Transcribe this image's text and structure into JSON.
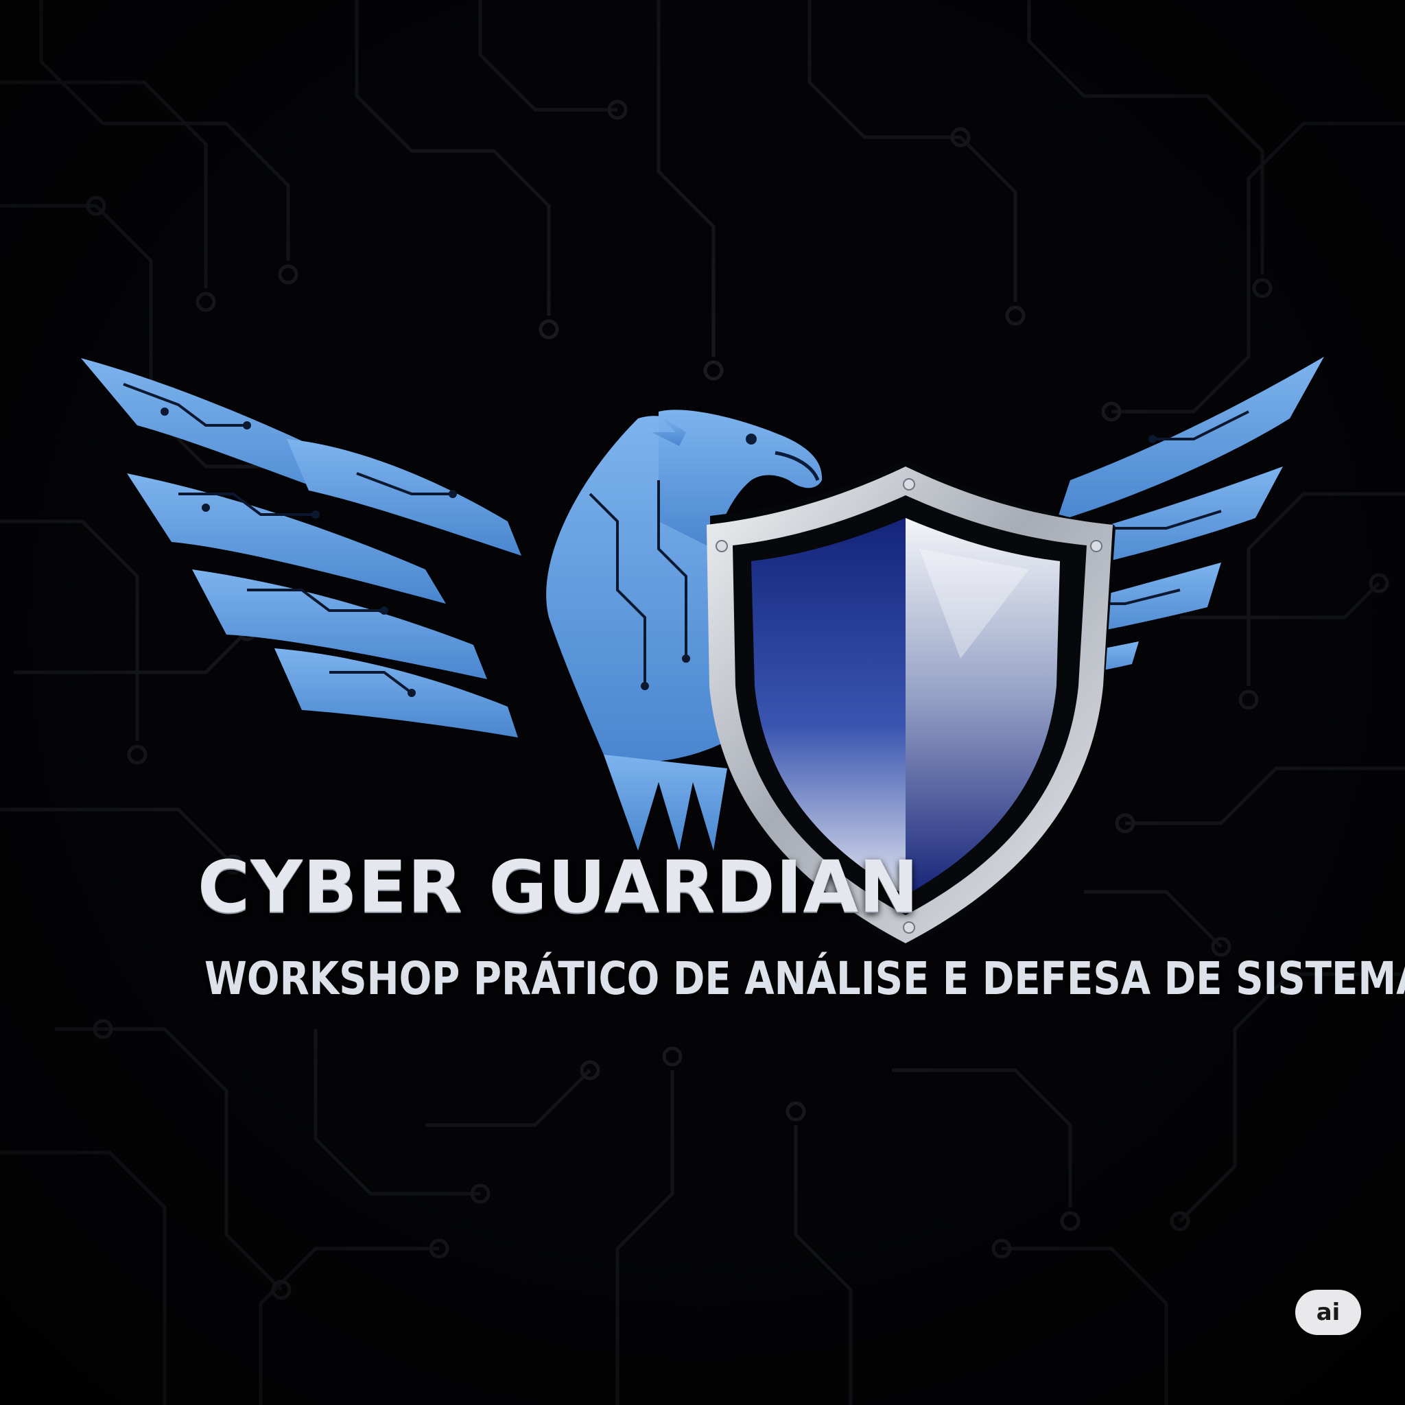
{
  "brand": {
    "title": "CYBER GUARDIAN",
    "subtitle": "WORKSHOP PRÁTICO DE ANÁLISE E DEFESA DE SISTEMAS"
  },
  "badge": {
    "label": "ai"
  },
  "colors": {
    "background": "#030305",
    "circuit_trace": "#1a1c22",
    "eagle": "#5c9ade",
    "shield_rim": "#c9ccd2",
    "shield_blue": "#1a2c82",
    "text": "#e4e8ee"
  },
  "icons": {
    "emblem": "eagle-icon",
    "shield": "shield-icon"
  }
}
